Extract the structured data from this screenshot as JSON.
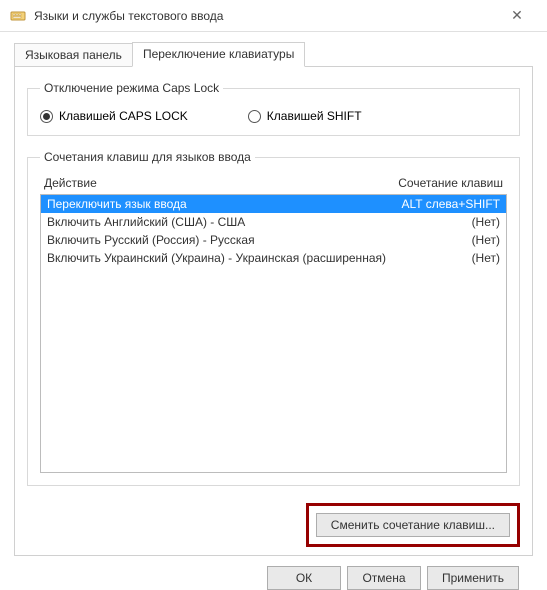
{
  "window": {
    "title": "Языки и службы текстового ввода"
  },
  "tabs": {
    "inactive": "Языковая панель",
    "active": "Переключение клавиатуры"
  },
  "capslock": {
    "legend": "Отключение режима Caps Lock",
    "opt_caps": "Клавишей CAPS LOCK",
    "opt_shift": "Клавишей SHIFT"
  },
  "hotkeys": {
    "legend": "Сочетания клавиш для языков ввода",
    "col_action": "Действие",
    "col_combo": "Сочетание клавиш",
    "rows": [
      {
        "action": "Переключить язык ввода",
        "combo": "ALT слева+SHIFT",
        "selected": true
      },
      {
        "action": "Включить Английский (США) - США",
        "combo": "(Нет)",
        "selected": false
      },
      {
        "action": "Включить Русский (Россия) - Русская",
        "combo": "(Нет)",
        "selected": false
      },
      {
        "action": "Включить Украинский (Украина) - Украинская (расширенная)",
        "combo": "(Нет)",
        "selected": false
      }
    ],
    "change_btn": "Сменить сочетание клавиш..."
  },
  "buttons": {
    "ok": "ОК",
    "cancel": "Отмена",
    "apply": "Применить"
  }
}
